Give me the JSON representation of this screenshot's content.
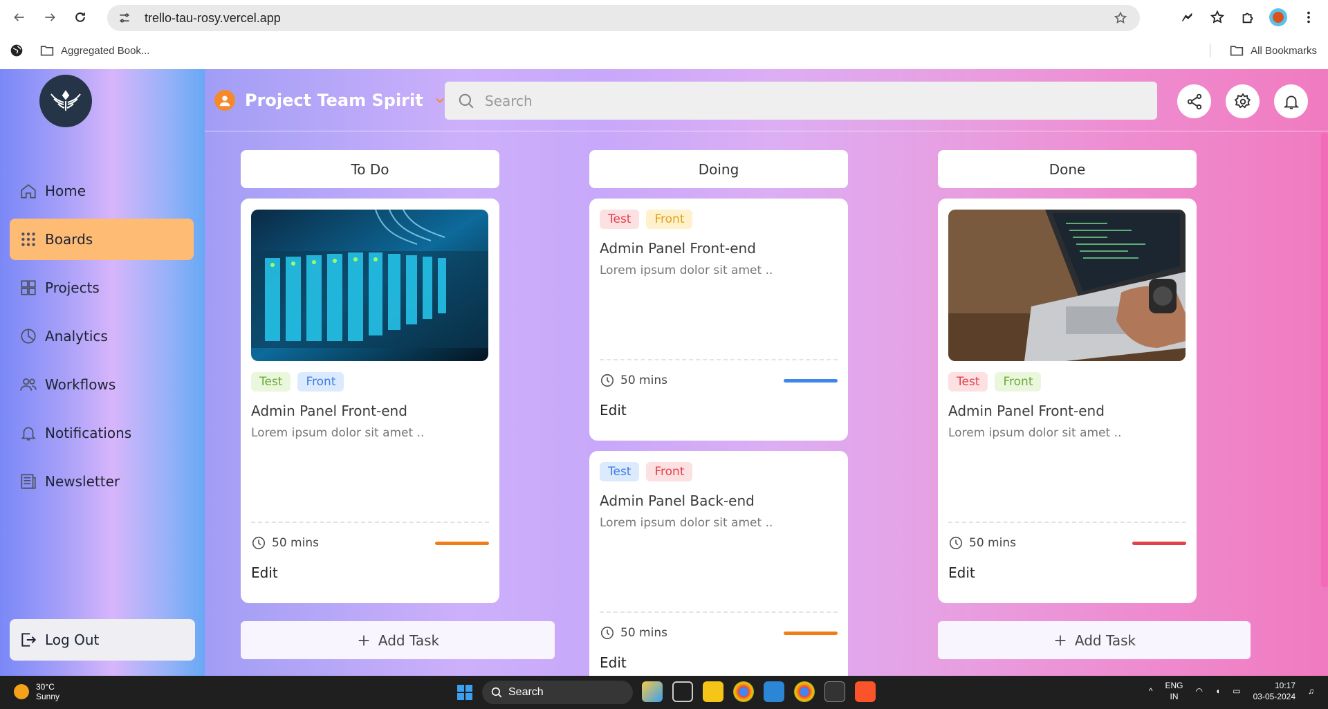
{
  "browser": {
    "url": "trello-tau-rosy.vercel.app",
    "bookmark_folder": "Aggregated Book...",
    "all_bookmarks": "All Bookmarks"
  },
  "app": {
    "team_name": "Project Team Spirit",
    "search_placeholder": "Search"
  },
  "sidebar": {
    "items": [
      {
        "label": "Home",
        "icon": "home-icon"
      },
      {
        "label": "Boards",
        "icon": "grid-dots-icon"
      },
      {
        "label": "Projects",
        "icon": "squares-icon"
      },
      {
        "label": "Analytics",
        "icon": "pie-chart-icon"
      },
      {
        "label": "Workflows",
        "icon": "users-icon"
      },
      {
        "label": "Notifications",
        "icon": "bell-icon"
      },
      {
        "label": "Newsletter",
        "icon": "newspaper-icon"
      }
    ],
    "logout": "Log Out"
  },
  "columns": [
    {
      "title": "To Do",
      "add_task": "Add Task",
      "cards": [
        {
          "tags": [
            "Test",
            "Front"
          ],
          "title": "Admin Panel Front-end",
          "desc": "Lorem ipsum dolor sit amet ..",
          "time": "50 mins",
          "edit": "Edit",
          "progress_color": "#f07d1a"
        }
      ]
    },
    {
      "title": "Doing",
      "cards": [
        {
          "tags": [
            "Test",
            "Front"
          ],
          "title": "Admin Panel Front-end",
          "desc": "Lorem ipsum dolor sit amet ..",
          "time": "50 mins",
          "edit": "Edit",
          "progress_color": "#3d86ea"
        },
        {
          "tags": [
            "Test",
            "Front"
          ],
          "title": "Admin Panel Back-end",
          "desc": "Lorem ipsum dolor sit amet ..",
          "time": "50 mins",
          "edit": "Edit",
          "progress_color": "#f07d1a"
        }
      ]
    },
    {
      "title": "Done",
      "add_task": "Add Task",
      "cards": [
        {
          "tags": [
            "Test",
            "Front"
          ],
          "title": "Admin Panel Front-end",
          "desc": "Lorem ipsum dolor sit amet ..",
          "time": "50 mins",
          "edit": "Edit",
          "progress_color": "#e0414c"
        }
      ]
    }
  ],
  "taskbar": {
    "temp": "30°C",
    "weather": "Sunny",
    "search": "Search",
    "lang_top": "ENG",
    "lang_bottom": "IN",
    "time": "10:17",
    "date": "03-05-2024"
  }
}
